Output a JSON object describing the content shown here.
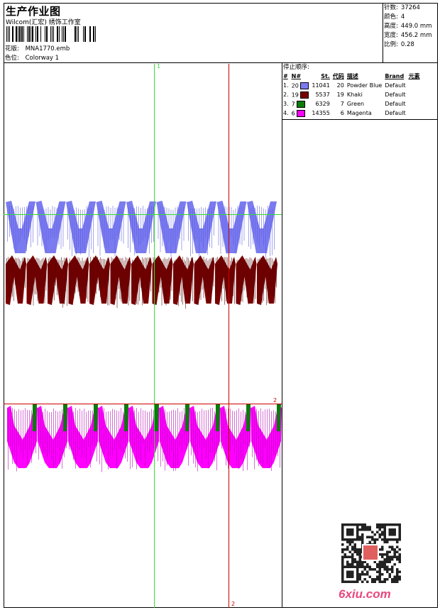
{
  "header": {
    "title": "生产作业图",
    "subtitle": "Wilcom(汇宏) 绣饰工作室",
    "design_label": "花版:",
    "design_value": "MNA1770.emb",
    "colorway_label": "色位:",
    "colorway_value": "Colorway 1"
  },
  "stats": [
    {
      "label": "针数:",
      "value": "37264"
    },
    {
      "label": "颜色:",
      "value": "4"
    },
    {
      "label": "高度:",
      "value": "449.0 mm"
    },
    {
      "label": "宽度:",
      "value": "456.2 mm"
    },
    {
      "label": "比例:",
      "value": "0.28"
    }
  ],
  "stop_sequence": {
    "title": "停止顺序:",
    "headers": [
      "#",
      "N#",
      "St.",
      "代码",
      "描述",
      "Brand",
      "元素"
    ],
    "rows": [
      {
        "num": "1.",
        "n": "20",
        "color": "#7b7bf0",
        "st": "11041",
        "code": "20",
        "desc": "Powder Blue",
        "brand": "Default"
      },
      {
        "num": "2.",
        "n": "19",
        "color": "#7a0000",
        "st": "5537",
        "code": "19",
        "desc": "Khaki",
        "brand": "Default"
      },
      {
        "num": "3.",
        "n": "7",
        "color": "#0a7a0a",
        "st": "6329",
        "code": "7",
        "desc": "Green",
        "brand": "Default"
      },
      {
        "num": "4.",
        "n": "6",
        "color": "#ff00ff",
        "st": "14355",
        "code": "6",
        "desc": "Magenta",
        "brand": "Default"
      }
    ]
  },
  "guides": {
    "v1_label": "1",
    "h2_label": "2",
    "v2_label": "2"
  },
  "watermark": "6xiu.com",
  "colors": {
    "blue": "#7b7bf0",
    "darkred": "#7a0000",
    "green": "#0a7a0a",
    "magenta": "#ff00ff",
    "guide_green": "#33dd33",
    "guide_red": "#cc0000"
  }
}
